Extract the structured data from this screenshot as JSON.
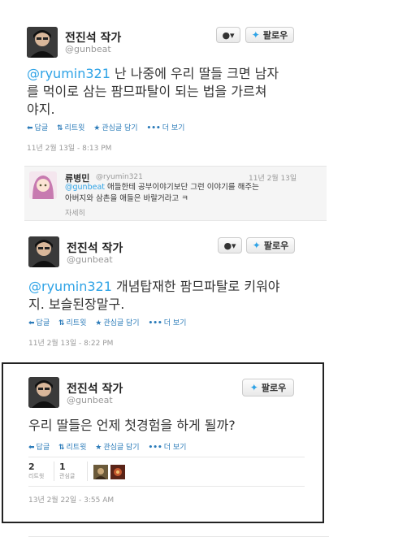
{
  "tweet1": {
    "name": "전진석 작가",
    "handle": "@gunbeat",
    "mention": "@ryumin321",
    "text_line1": " 난 나중에 우리 딸들 크면 남자",
    "text_line2": "를 먹이로 삼는 팜므파탈이 되는 법을 가르쳐",
    "text_line3": "야지.",
    "time": "11년 2월 13일 - 8:13 PM"
  },
  "reply": {
    "name": "류병민",
    "handle": "@ryumin321",
    "date": "11년 2월 13일",
    "mention": "@gunbeat",
    "text_line1": " 애들한테 공부이야기보단 그런 이야기를 해주는",
    "text_line2": "아버지와 삼촌을 애들은 바랄거라고 ㅋ",
    "detail": "자세히"
  },
  "tweet2": {
    "name": "전진석 작가",
    "handle": "@gunbeat",
    "mention": "@ryumin321",
    "text_line1": " 개념탑재한 팜므파탈로 키워야",
    "text_line2": "지. 보슬된장말구.",
    "time": "11년 2월 13일 - 8:22 PM"
  },
  "tweet3": {
    "name": "전진석 작가",
    "handle": "@gunbeat",
    "text": "우리 딸들은 언제 첫경험을 하게 될까?",
    "retweets_count": "2",
    "retweets_label": "리트윗",
    "favorites_count": "1",
    "favorites_label": "관심글",
    "time": "13년 2월 22일 - 3:55 AM"
  },
  "buttons": {
    "follow": "팔로우"
  },
  "actions": {
    "reply": "답글",
    "retweet": "리트윗",
    "favorite": "관심글 담기",
    "more": "더 보기"
  },
  "icons": {
    "reply": "reply-arrow-icon",
    "retweet": "retweet-icon",
    "favorite": "star-icon",
    "more": "dots-icon",
    "user": "user-icon",
    "bird": "twitter-bird-icon"
  },
  "colors": {
    "link": "#2fa3e6",
    "action": "#2b7bb9"
  }
}
